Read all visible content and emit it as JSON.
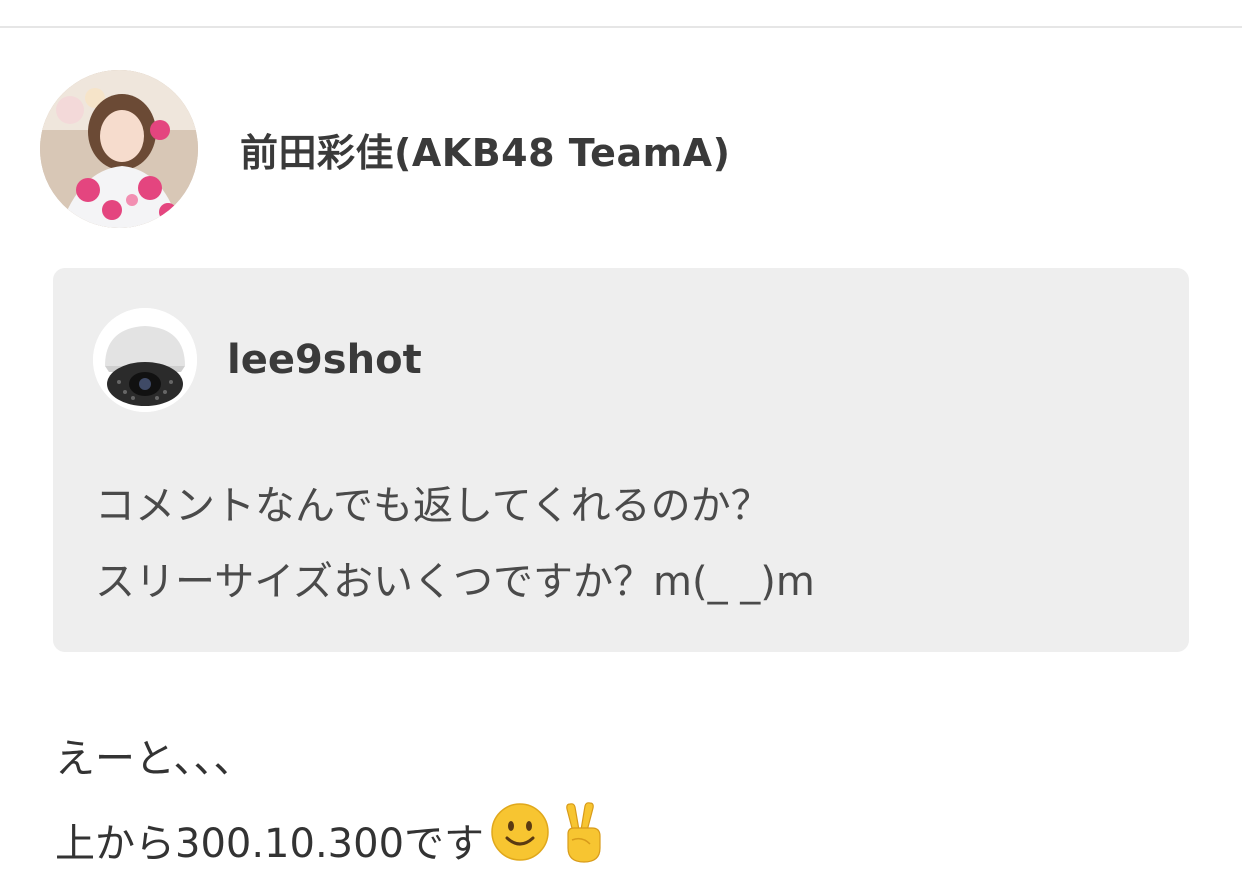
{
  "author": {
    "name": "前田彩佳(AKB48 TeamA)",
    "avatar_icon": "author-avatar-photo"
  },
  "quoted_comment": {
    "username": "lee9shot",
    "avatar_icon": "security-camera-avatar",
    "lines": [
      "コメントなんでも返してくれるのか？",
      "スリーサイズおいくつですか？m(_ _)m"
    ]
  },
  "reply": {
    "lines": [
      "えーと、、、",
      "上から300.10.300です"
    ],
    "emojis": [
      "slightly-smiling-face-icon",
      "victory-hand-icon"
    ]
  },
  "colors": {
    "card_background": "#eeeeee",
    "text_primary": "#3a3a3a",
    "divider": "#e6e6e6"
  }
}
